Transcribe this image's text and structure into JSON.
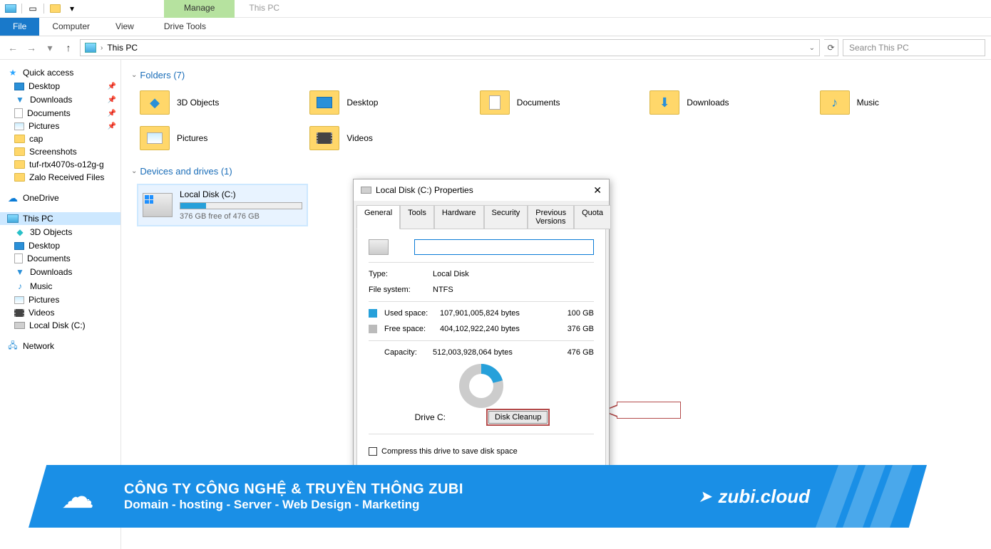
{
  "titlebar": {
    "context_tab": "Manage",
    "context_title": "This PC"
  },
  "ribbon": {
    "file": "File",
    "computer": "Computer",
    "view": "View",
    "drive_tools": "Drive Tools"
  },
  "nav": {
    "location": "This PC",
    "search_placeholder": "Search This PC"
  },
  "sidebar": {
    "quick_access": "Quick access",
    "qa_items": [
      {
        "label": "Desktop",
        "pinned": true
      },
      {
        "label": "Downloads",
        "pinned": true
      },
      {
        "label": "Documents",
        "pinned": true
      },
      {
        "label": "Pictures",
        "pinned": true
      },
      {
        "label": "cap"
      },
      {
        "label": "Screenshots"
      },
      {
        "label": "tuf-rtx4070s-o12g-g"
      },
      {
        "label": "Zalo Received Files"
      }
    ],
    "onedrive": "OneDrive",
    "this_pc": "This PC",
    "pc_items": [
      {
        "label": "3D Objects"
      },
      {
        "label": "Desktop"
      },
      {
        "label": "Documents"
      },
      {
        "label": "Downloads"
      },
      {
        "label": "Music"
      },
      {
        "label": "Pictures"
      },
      {
        "label": "Videos"
      },
      {
        "label": "Local Disk (C:)"
      }
    ],
    "network": "Network"
  },
  "content": {
    "folders_hdr": "Folders (7)",
    "folders": [
      "3D Objects",
      "Desktop",
      "Documents",
      "Downloads",
      "Music",
      "Pictures",
      "Videos"
    ],
    "devices_hdr": "Devices and drives (1)",
    "drive": {
      "name": "Local Disk (C:)",
      "free_text": "376 GB free of 476 GB",
      "used_pct": 21
    }
  },
  "dialog": {
    "title": "Local Disk (C:) Properties",
    "tabs": [
      "General",
      "Tools",
      "Hardware",
      "Security",
      "Previous Versions",
      "Quota"
    ],
    "type_lbl": "Type:",
    "type_val": "Local Disk",
    "fs_lbl": "File system:",
    "fs_val": "NTFS",
    "used_lbl": "Used space:",
    "used_bytes": "107,901,005,824 bytes",
    "used_gb": "100 GB",
    "free_lbl": "Free space:",
    "free_bytes": "404,102,922,240 bytes",
    "free_gb": "376 GB",
    "cap_lbl": "Capacity:",
    "cap_bytes": "512,003,928,064 bytes",
    "cap_gb": "476 GB",
    "drive_lbl": "Drive C:",
    "cleanup_btn": "Disk Cleanup",
    "compress_lbl": "Compress this drive to save disk space"
  },
  "banner": {
    "logo_text": "zubi",
    "line1": "CÔNG TY CÔNG NGHỆ & TRUYỀN THÔNG ZUBI",
    "line2": "Domain - hosting - Server - Web Design - Marketing",
    "site": "zubi.cloud"
  }
}
